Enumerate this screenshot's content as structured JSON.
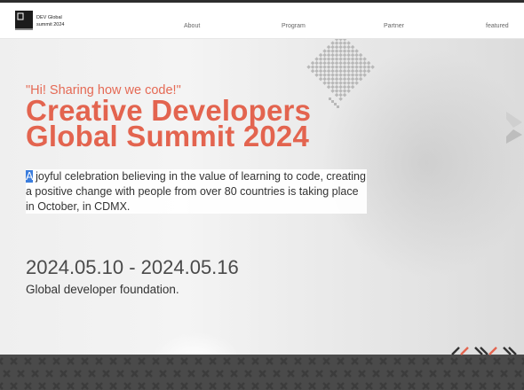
{
  "header": {
    "logo_text_1": "DEV Global",
    "logo_text_2": "summit 2024",
    "nav": [
      "About",
      "Program",
      "Partner",
      "featured"
    ]
  },
  "hero": {
    "quote": "\"Hi! Sharing how we code!\"",
    "title_line1": "Creative Developers",
    "title_line2": "Global Summit 2024",
    "desc_highlight": "A",
    "desc_rest": " joyful celebration believing in the value of learning to code, creating a positive change with people from over 80 countries is taking place in October, in CDMX.",
    "dates": "2024.05.10 - 2024.05.16",
    "foundation": "Global developer foundation."
  },
  "colors": {
    "accent": "#e3644f",
    "highlight": "#3b7ddd",
    "footer": "#4a4a4a"
  },
  "icons": [
    "chevron-right-icon",
    "logo-mark-icon"
  ]
}
